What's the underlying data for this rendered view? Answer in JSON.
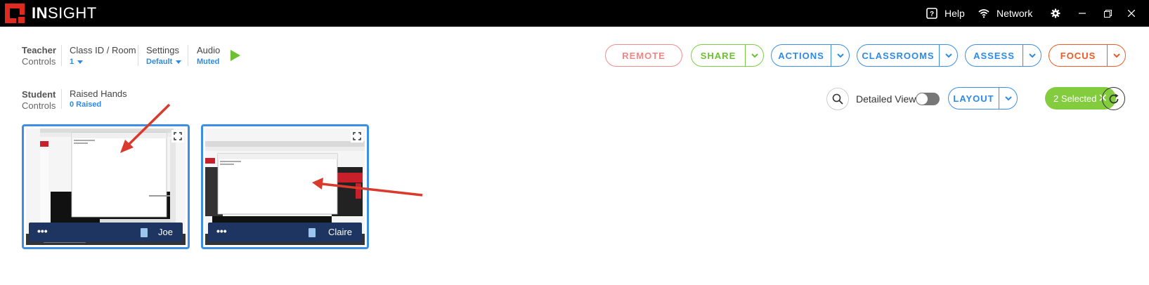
{
  "app": {
    "brand_bold": "IN",
    "brand_light": "SIGHT"
  },
  "titlebar": {
    "help_label": "Help",
    "network_label": "Network"
  },
  "teacher": {
    "title": "Teacher",
    "subtitle": "Controls",
    "class_label": "Class ID / Room",
    "class_value": "1",
    "settings_label": "Settings",
    "settings_value": "Default",
    "audio_label": "Audio",
    "audio_value": "Muted"
  },
  "actions": {
    "remote": "REMOTE",
    "share": "SHARE",
    "actions": "ACTIONS",
    "classrooms": "CLASSROOMS",
    "assess": "ASSESS",
    "focus": "FOCUS"
  },
  "student": {
    "title": "Student",
    "subtitle": "Controls",
    "raised_label": "Raised Hands",
    "raised_value": "0 Raised",
    "detailed_view_label": "Detailed View",
    "detailed_view_on": false,
    "layout": "LAYOUT",
    "selected": "2 Selected"
  },
  "tiles": [
    {
      "name": "Joe",
      "menu": "•••"
    },
    {
      "name": "Claire",
      "menu": "•••"
    }
  ],
  "colors": {
    "brand_red": "#e02a20",
    "accent_blue": "#2d8ae6",
    "accent_green": "#82cc3e",
    "accent_orange": "#ee5a24",
    "tile_bar": "#1d3560",
    "annotation_arrow": "#d93a2b"
  }
}
